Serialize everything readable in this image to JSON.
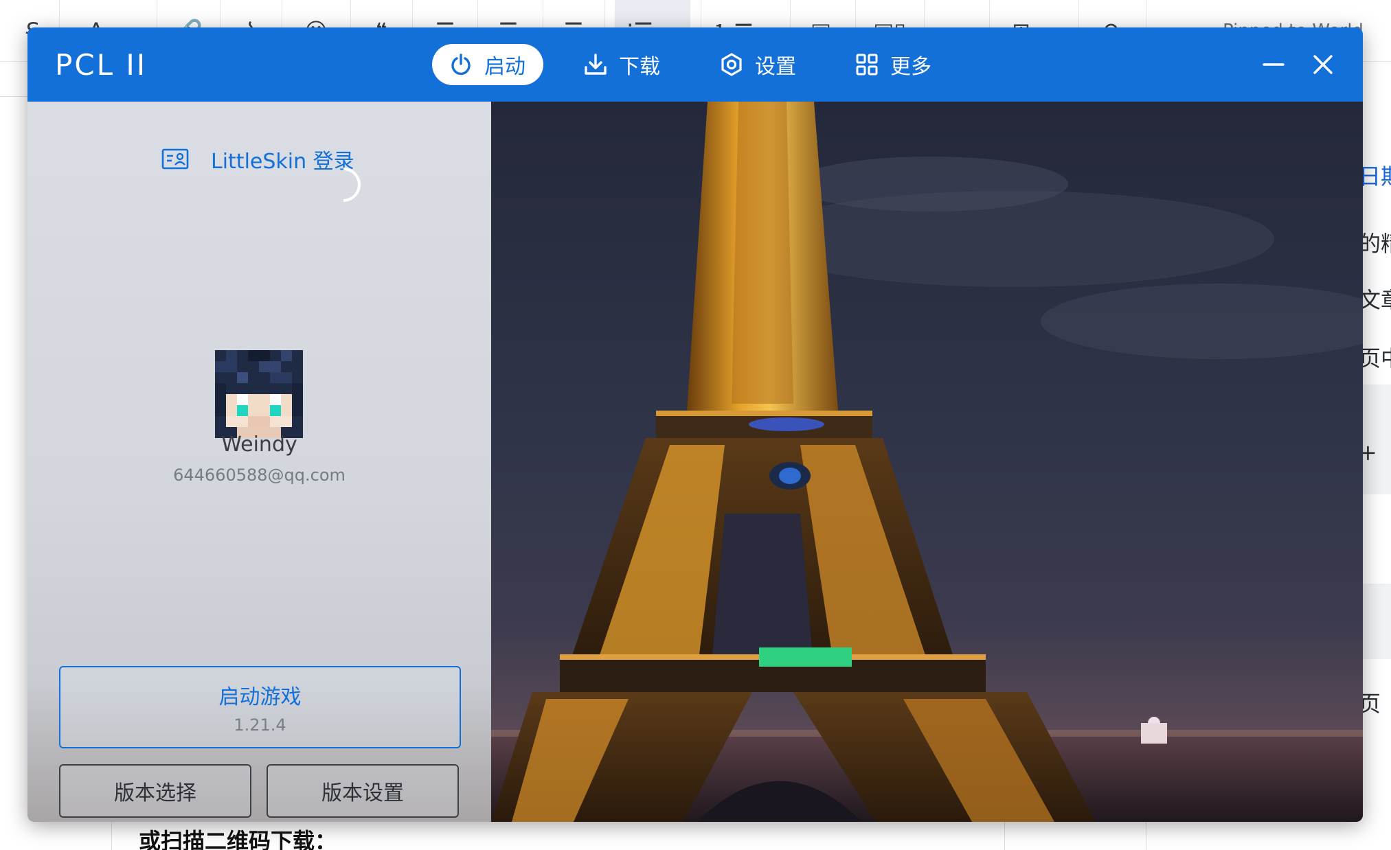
{
  "background_app": {
    "toolbar_icons": [
      "strikethrough-icon",
      "font-color-icon",
      "link-icon",
      "unlink-icon",
      "emoji-icon",
      "quote-icon",
      "align-left-icon",
      "align-center-icon",
      "align-right-icon",
      "unordered-list-icon",
      "ordered-list-icon",
      "image-icon",
      "gallery-icon",
      "video-icon",
      "table-icon",
      "undo-icon"
    ],
    "title_hint": "Pinned to World",
    "right_items": [
      "日期",
      "的精",
      "文章",
      "页中",
      "+",
      "页"
    ],
    "bottom_text": "或扫描二维码下载："
  },
  "launcher": {
    "title": "PCL II",
    "nav": [
      {
        "label": "启动",
        "icon": "power-icon",
        "active": true
      },
      {
        "label": "下载",
        "icon": "download-icon",
        "active": false
      },
      {
        "label": "设置",
        "icon": "settings-icon",
        "active": false
      },
      {
        "label": "更多",
        "icon": "grid-icon",
        "active": false
      }
    ],
    "accent_color": "#1370d8",
    "login": {
      "label": "LittleSkin 登录"
    },
    "player": {
      "name": "Weindy",
      "email": "644660588@qq.com"
    },
    "launch": {
      "label": "启动游戏",
      "version": "1.21.4"
    },
    "version_select": "版本选择",
    "version_settings": "版本设置"
  }
}
